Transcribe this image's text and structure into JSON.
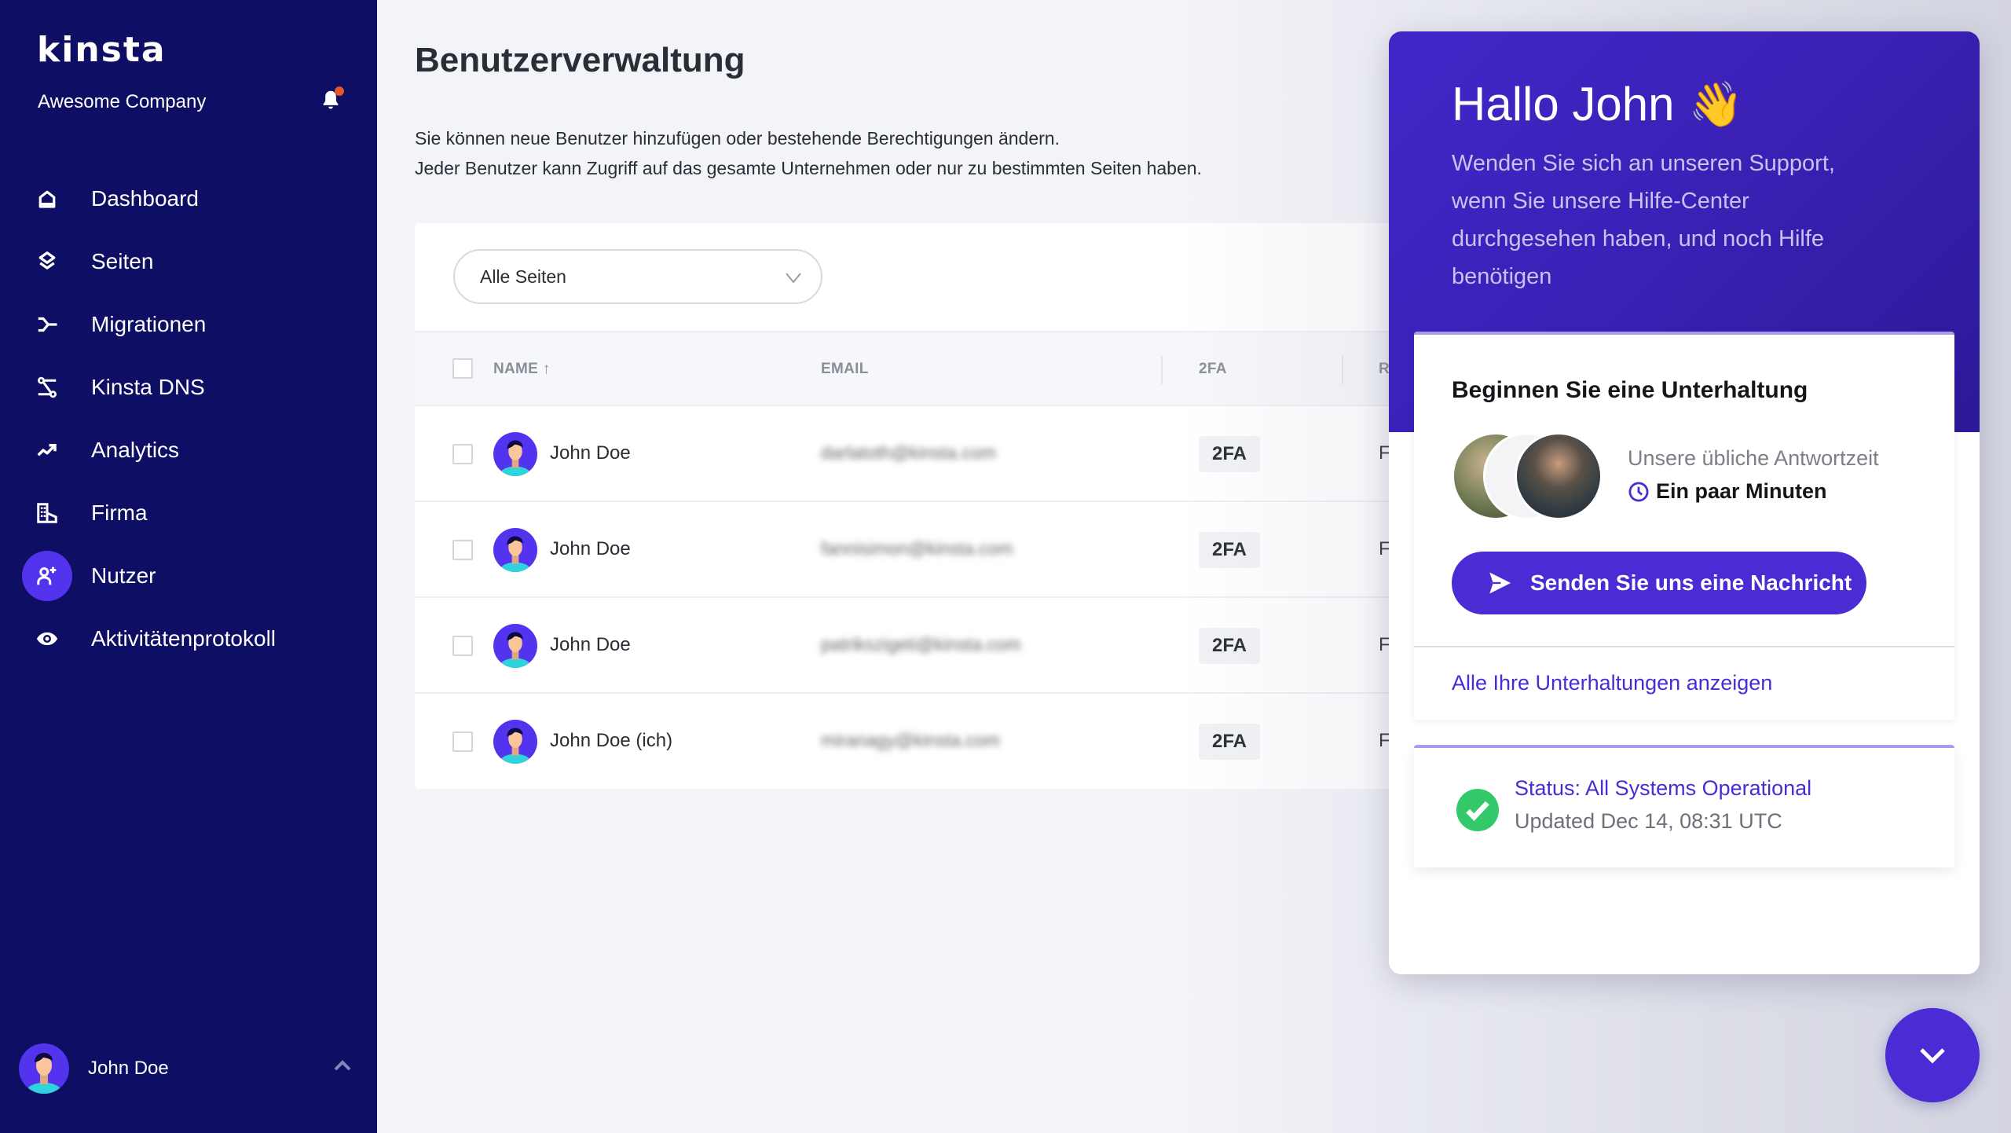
{
  "sidebar": {
    "logo": "kinsta",
    "company": "Awesome Company",
    "notification_icon": "bell-icon",
    "notification_dot_color": "#e0582b",
    "items": [
      {
        "label": "Dashboard",
        "icon": "home-icon",
        "active": false
      },
      {
        "label": "Seiten",
        "icon": "layers-icon",
        "active": false
      },
      {
        "label": "Migrationen",
        "icon": "migration-icon",
        "active": false
      },
      {
        "label": "Kinsta DNS",
        "icon": "dns-icon",
        "active": false
      },
      {
        "label": "Analytics",
        "icon": "trend-icon",
        "active": false
      },
      {
        "label": "Firma",
        "icon": "building-icon",
        "active": false
      },
      {
        "label": "Nutzer",
        "icon": "user-add-icon",
        "active": true
      },
      {
        "label": "Aktivitätenprotokoll",
        "icon": "eye-icon",
        "active": false
      }
    ],
    "user": {
      "name": "John Doe",
      "expand_icon": "chevron-up-icon"
    }
  },
  "main": {
    "title": "Benutzerverwaltung",
    "description": [
      "Sie können neue Benutzer hinzufügen oder bestehende Berechtigungen ändern.",
      "Jeder Benutzer kann Zugriff auf das gesamte Unternehmen oder nur zu bestimmten Seiten haben."
    ],
    "filter": {
      "selected": "Alle Seiten"
    },
    "table": {
      "columns": [
        "NAME ↑",
        "EMAIL",
        "2FA",
        "R"
      ],
      "rows": [
        {
          "name": "John Doe",
          "email": "darlatoth@kinsta.com",
          "twofa": "2FA",
          "role": "F"
        },
        {
          "name": "John Doe",
          "email": "fannisimon@kinsta.com",
          "twofa": "2FA",
          "role": "F"
        },
        {
          "name": "John Doe",
          "email": "patrikszigeti@kinsta.com",
          "twofa": "2FA",
          "role": "F"
        },
        {
          "name": "John Doe (ich)",
          "email": "miranagy@kinsta.com",
          "twofa": "2FA",
          "role": "F"
        }
      ]
    }
  },
  "chat": {
    "greeting": "Hallo John",
    "greeting_emoji": "👋",
    "subtitle": "Wenden Sie sich an unseren Support, wenn Sie unsere Hilfe-Center durchgesehen haben, und noch Hilfe benötigen",
    "conversation": {
      "title": "Beginnen Sie eine Unterhaltung",
      "response_label": "Unsere übliche Antwortzeit",
      "response_value": "Ein paar Minuten",
      "send_button": "Senden Sie uns eine Nachricht",
      "all_conversations_link": "Alle Ihre Unterhaltungen anzeigen"
    },
    "status": {
      "title": "Status: All Systems Operational",
      "updated": "Updated Dec 14, 08:31 UTC",
      "color": "#33c96a"
    },
    "accent_color": "#4a2bd4"
  }
}
